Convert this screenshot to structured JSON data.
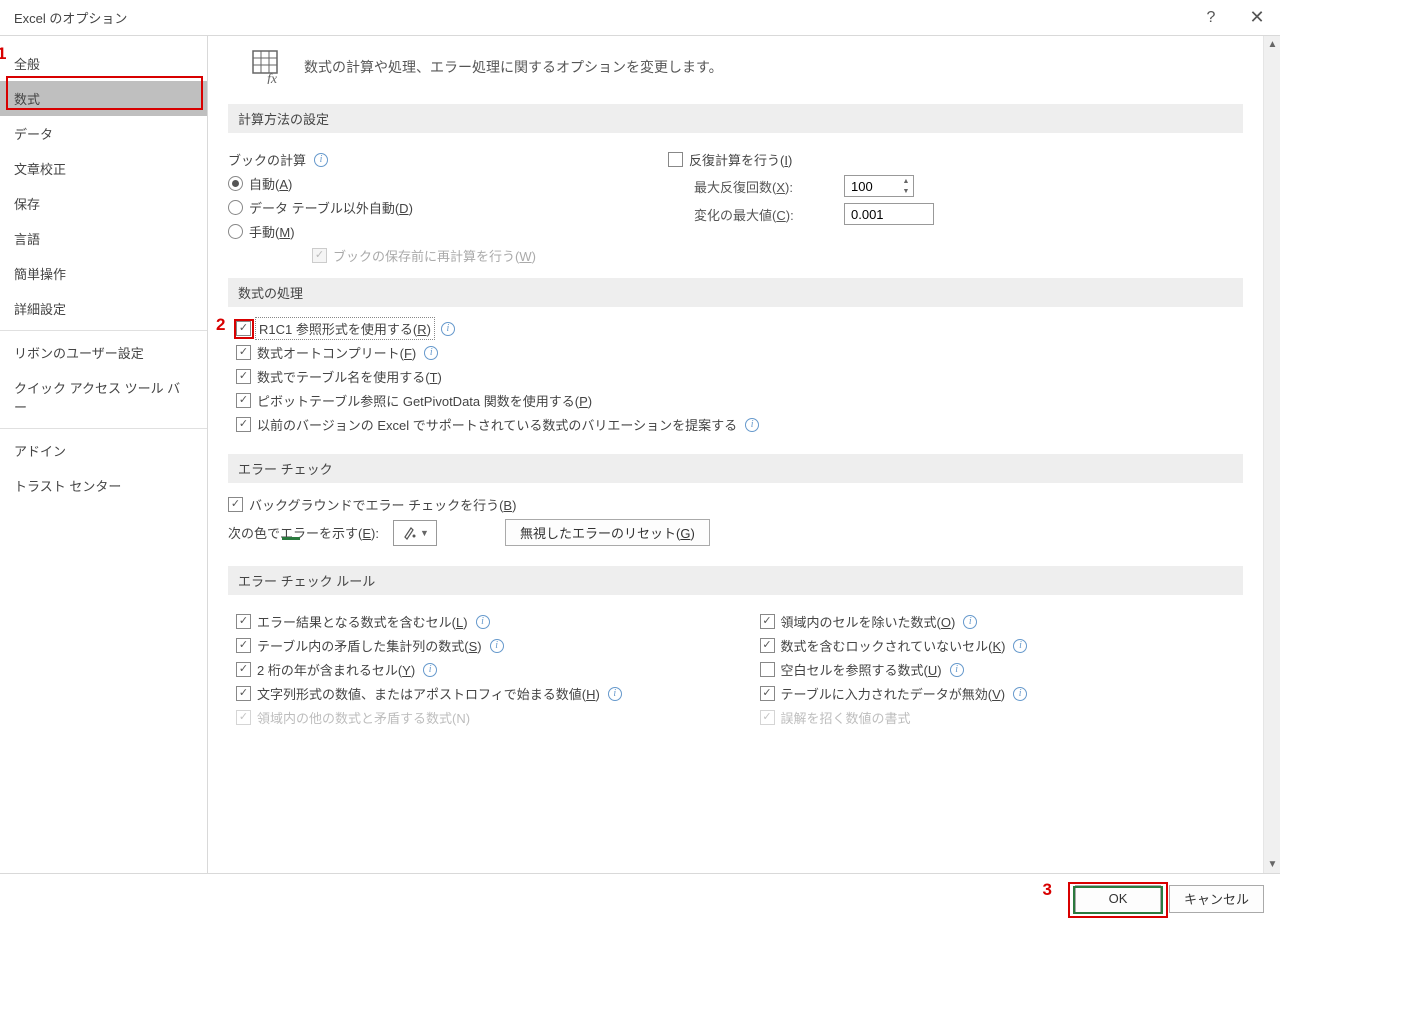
{
  "title": "Excel のオプション",
  "titlebar_help": "?",
  "titlebar_close": "✕",
  "sidebar": {
    "items": [
      "全般",
      "数式",
      "データ",
      "文章校正",
      "保存",
      "言語",
      "簡単操作",
      "詳細設定",
      "リボンのユーザー設定",
      "クイック アクセス ツール バー",
      "アドイン",
      "トラスト センター"
    ],
    "selected_index": 1
  },
  "annotations": {
    "one": "1",
    "two": "2",
    "three": "3"
  },
  "intro": "数式の計算や処理、エラー処理に関するオプションを変更します。",
  "section_calc": "計算方法の設定",
  "calc": {
    "book_calc_label": "ブックの計算",
    "radio_auto": "自動(A)",
    "radio_auto_except": "データ テーブル以外自動(D)",
    "radio_manual": "手動(M)",
    "recalc_on_save": "ブックの保存前に再計算を行う(W)",
    "iterate_label": "反復計算を行う(I)",
    "max_iter_label": "最大反復回数(X):",
    "max_iter_value": "100",
    "max_change_label": "変化の最大値(C):",
    "max_change_value": "0.001"
  },
  "section_formula": "数式の処理",
  "formula": {
    "r1c1": "R1C1 参照形式を使用する(R)",
    "autocomplete": "数式オートコンプリート(F)",
    "table_names": "数式でテーブル名を使用する(T)",
    "getpivotdata": "ピボットテーブル参照に GetPivotData 関数を使用する(P)",
    "legacy_formulas": "以前のバージョンの Excel でサポートされている数式のバリエーションを提案する"
  },
  "section_err": "エラー チェック",
  "err": {
    "bg_check": "バックグラウンドでエラー チェックを行う(B)",
    "color_label": "次の色でエラーを示す(E):",
    "reset_btn": "無視したエラーのリセット(G)"
  },
  "section_rules": "エラー チェック ルール",
  "rules_left": [
    "エラー結果となる数式を含むセル(L)",
    "テーブル内の矛盾した集計列の数式(S)",
    "2 桁の年が含まれるセル(Y)",
    "文字列形式の数値、またはアポストロフィで始まる数値(H)",
    "領域内の他の数式と矛盾する数式(N)"
  ],
  "rules_right": [
    "領域内のセルを除いた数式(O)",
    "数式を含むロックされていないセル(K)",
    "空白セルを参照する数式(U)",
    "テーブルに入力されたデータが無効(V)",
    "誤解を招く数値の書式"
  ],
  "footer": {
    "ok": "OK",
    "cancel": "キャンセル"
  }
}
